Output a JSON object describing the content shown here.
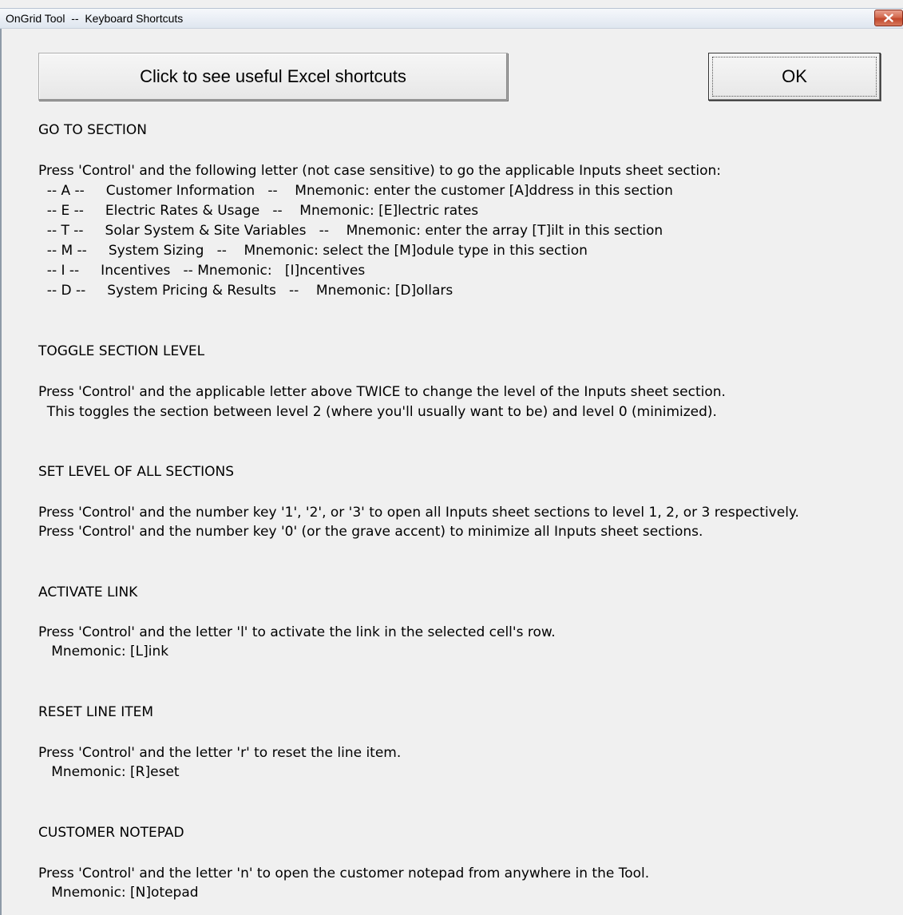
{
  "window": {
    "title": "OnGrid Tool  --  Keyboard Shortcuts"
  },
  "buttons": {
    "excel_shortcuts": "Click to see useful Excel shortcuts",
    "ok": "OK"
  },
  "sections": {
    "goto": {
      "heading": "GO TO SECTION",
      "intro": "Press 'Control' and the following letter (not case sensitive) to go the applicable Inputs sheet section:",
      "items": [
        "  -- A --     Customer Information   --    Mnemonic: enter the customer [A]ddress in this section",
        "  -- E --     Electric Rates & Usage   --    Mnemonic: [E]lectric rates",
        "  -- T --     Solar System & Site Variables   --    Mnemonic: enter the array [T]ilt in this section",
        "  -- M --     System Sizing   --    Mnemonic: select the [M]odule type in this section",
        "  -- I --     Incentives   -- Mnemonic:   [I]ncentives",
        "  -- D --     System Pricing & Results   --    Mnemonic: [D]ollars"
      ]
    },
    "toggle": {
      "heading": "TOGGLE SECTION LEVEL",
      "lines": [
        "Press 'Control' and the applicable letter above TWICE to change the level of the Inputs sheet section.",
        "  This toggles the section between level 2 (where you'll usually want to be) and level 0 (minimized)."
      ]
    },
    "setlevel": {
      "heading": "SET LEVEL OF ALL SECTIONS",
      "lines": [
        "Press 'Control' and the number key '1', '2', or '3' to open all Inputs sheet sections to level 1, 2, or 3 respectively.",
        "Press 'Control' and the number key '0' (or the grave accent) to minimize all Inputs sheet sections."
      ]
    },
    "link": {
      "heading": "ACTIVATE LINK",
      "lines": [
        "Press 'Control' and the letter 'l' to activate the link in the selected cell's row.",
        "   Mnemonic: [L]ink"
      ]
    },
    "reset": {
      "heading": "RESET LINE ITEM",
      "lines": [
        "Press 'Control' and the letter 'r' to reset the line item.",
        "   Mnemonic: [R]eset"
      ]
    },
    "notepad": {
      "heading": "CUSTOMER NOTEPAD",
      "lines": [
        "Press 'Control' and the letter 'n' to open the customer notepad from anywhere in the Tool.",
        "   Mnemonic: [N]otepad"
      ]
    }
  }
}
